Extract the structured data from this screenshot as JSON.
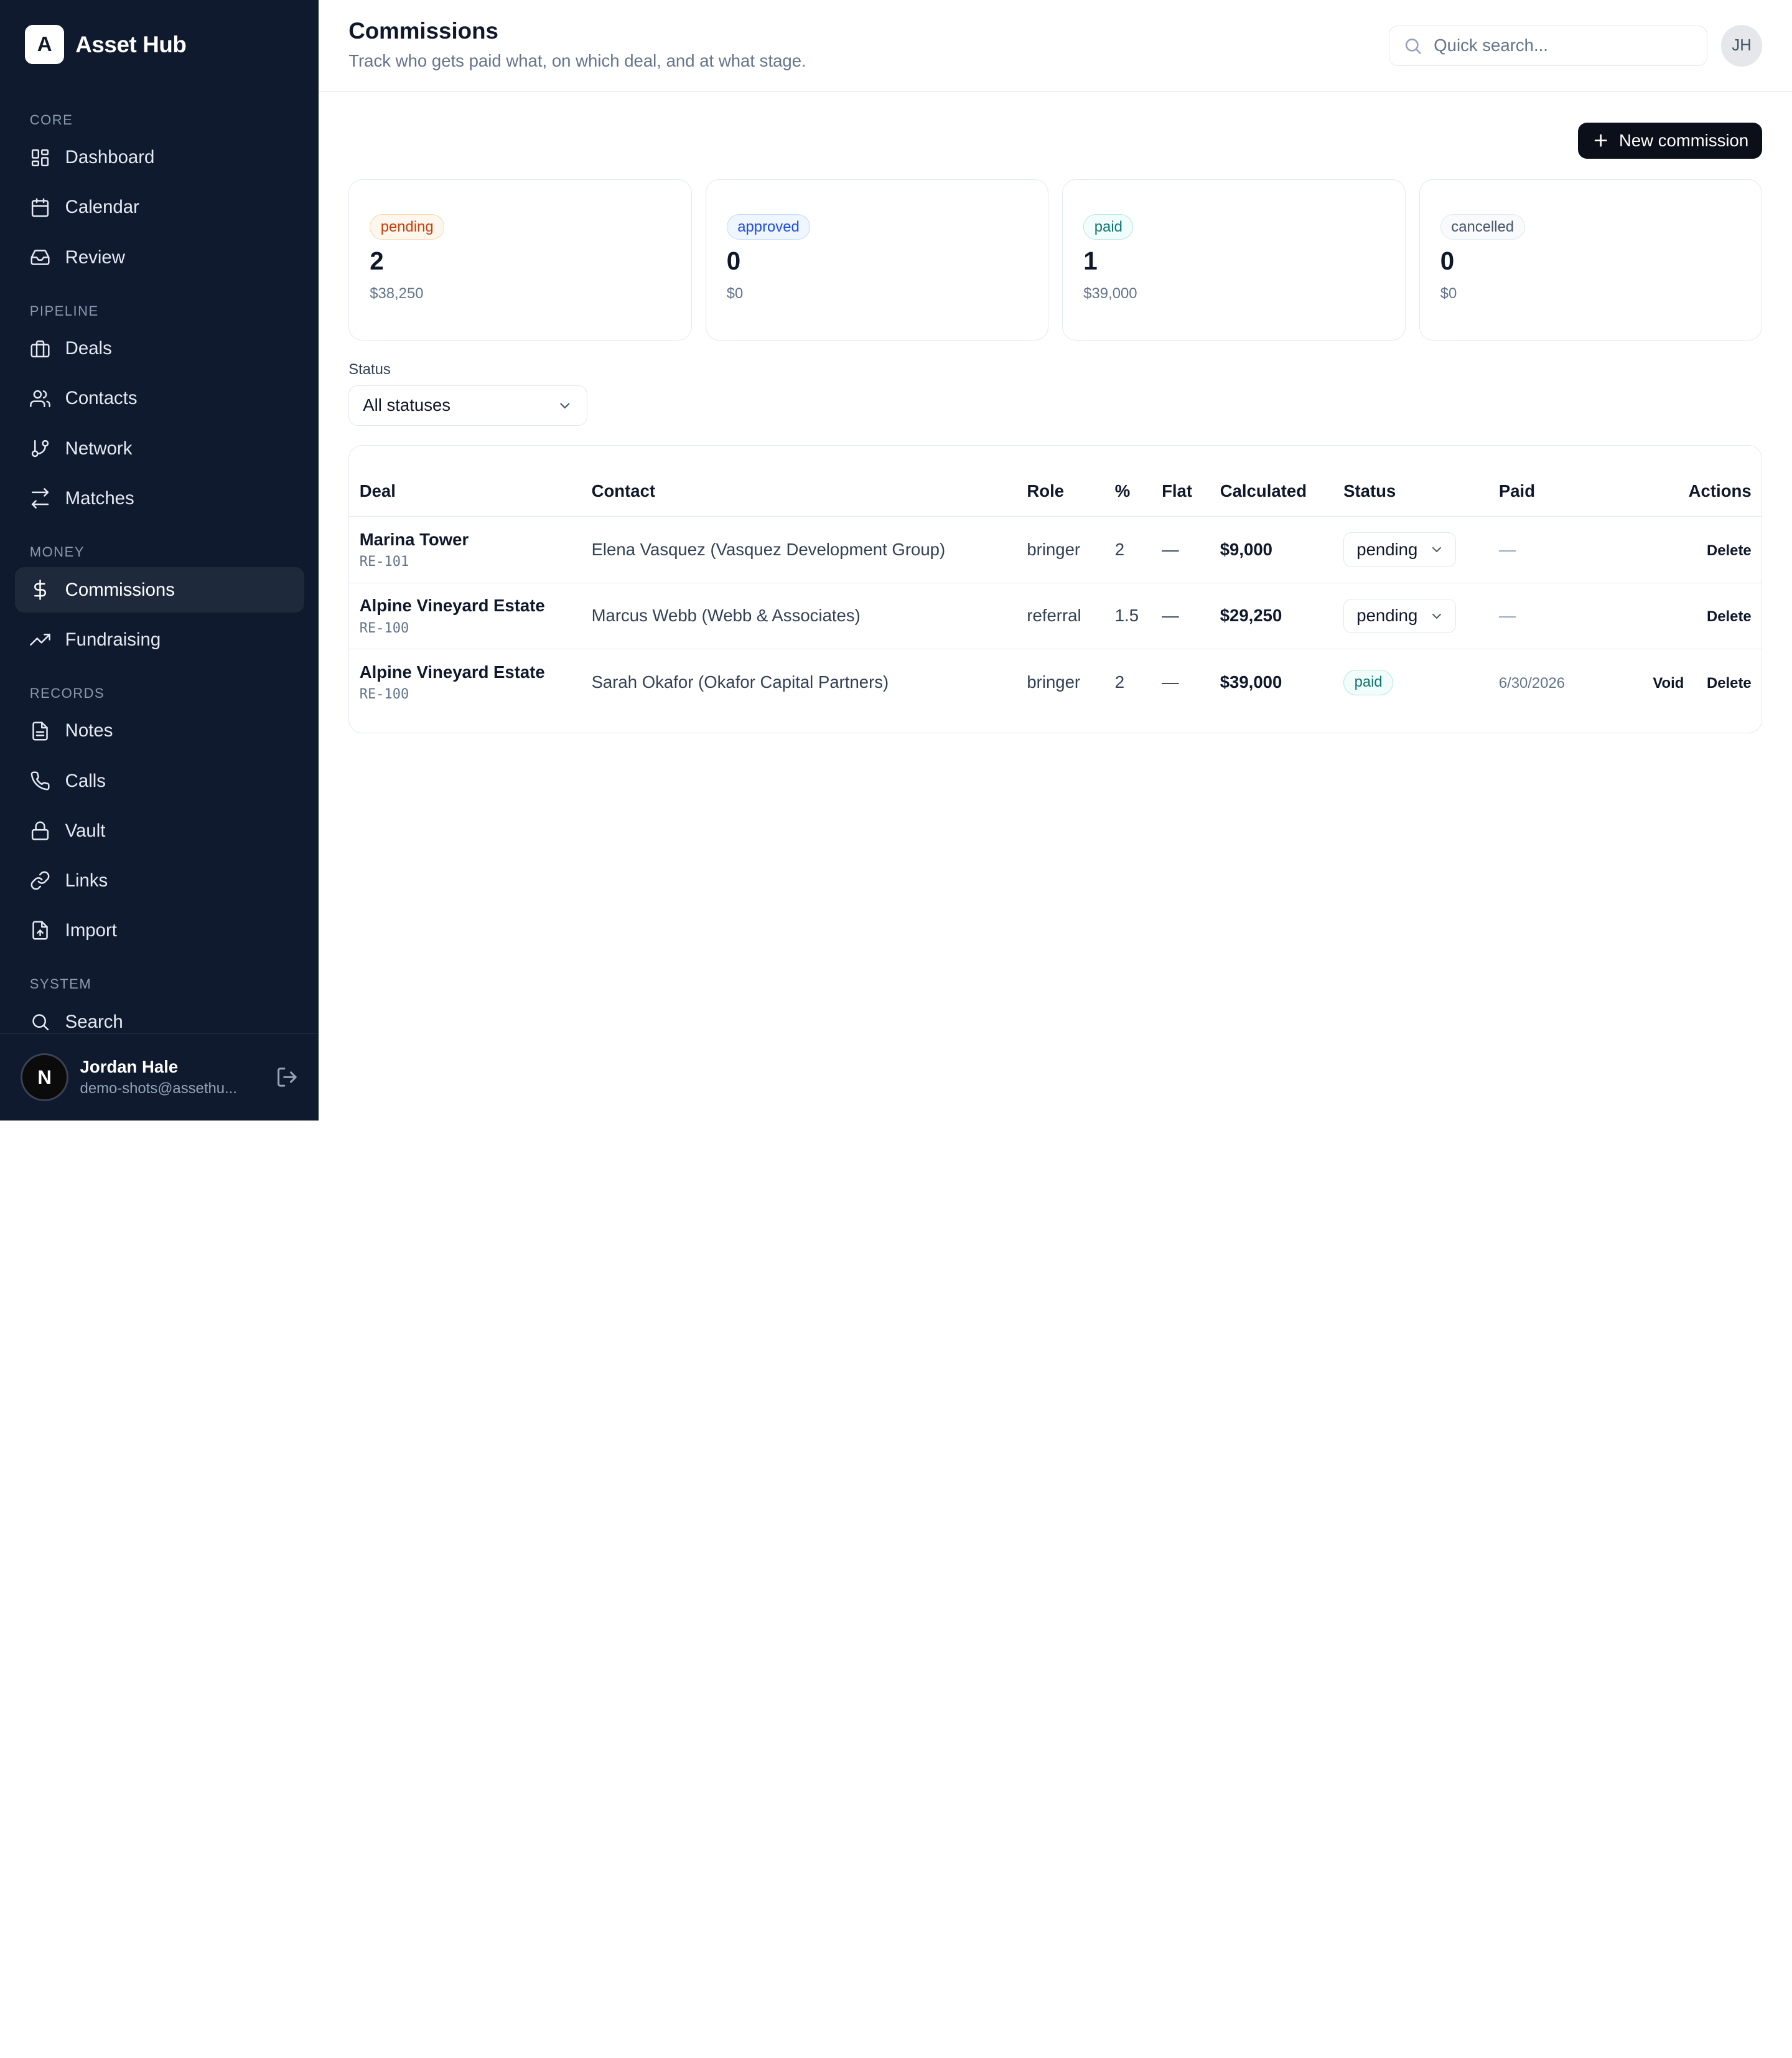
{
  "brand": {
    "logo_letter": "A",
    "name": "Asset Hub"
  },
  "sidebar": {
    "sections": [
      {
        "title": "CORE",
        "items": [
          {
            "label": "Dashboard",
            "icon": "dashboard-icon"
          },
          {
            "label": "Calendar",
            "icon": "calendar-icon"
          },
          {
            "label": "Review",
            "icon": "inbox-icon"
          }
        ]
      },
      {
        "title": "PIPELINE",
        "items": [
          {
            "label": "Deals",
            "icon": "briefcase-icon"
          },
          {
            "label": "Contacts",
            "icon": "users-icon"
          },
          {
            "label": "Network",
            "icon": "git-branch-icon"
          },
          {
            "label": "Matches",
            "icon": "arrows-icon"
          }
        ]
      },
      {
        "title": "MONEY",
        "items": [
          {
            "label": "Commissions",
            "icon": "dollar-icon",
            "active": true
          },
          {
            "label": "Fundraising",
            "icon": "trending-up-icon"
          }
        ]
      },
      {
        "title": "RECORDS",
        "items": [
          {
            "label": "Notes",
            "icon": "file-text-icon"
          },
          {
            "label": "Calls",
            "icon": "phone-icon"
          },
          {
            "label": "Vault",
            "icon": "lock-icon"
          },
          {
            "label": "Links",
            "icon": "link-icon"
          },
          {
            "label": "Import",
            "icon": "file-upload-icon"
          }
        ]
      },
      {
        "title": "SYSTEM",
        "items": [
          {
            "label": "Search",
            "icon": "search-icon"
          }
        ]
      }
    ],
    "user": {
      "avatar_letter": "N",
      "name": "Jordan Hale",
      "email": "demo-shots@assethu..."
    }
  },
  "header": {
    "title": "Commissions",
    "subtitle": "Track who gets paid what, on which deal, and at what stage.",
    "search_placeholder": "Quick search...",
    "avatar_initials": "JH"
  },
  "toolbar": {
    "new_label": "New commission"
  },
  "summary": [
    {
      "status": "pending",
      "count": "2",
      "amount": "$38,250"
    },
    {
      "status": "approved",
      "count": "0",
      "amount": "$0"
    },
    {
      "status": "paid",
      "count": "1",
      "amount": "$39,000"
    },
    {
      "status": "cancelled",
      "count": "0",
      "amount": "$0"
    }
  ],
  "filter": {
    "label": "Status",
    "value": "All statuses"
  },
  "table": {
    "columns": [
      "Deal",
      "Contact",
      "Role",
      "%",
      "Flat",
      "Calculated",
      "Status",
      "Paid",
      "Actions"
    ],
    "rows": [
      {
        "deal": "Marina Tower",
        "code": "RE-101",
        "contact": "Elena Vasquez (Vasquez Development Group)",
        "role": "bringer",
        "pct": "2",
        "flat": "—",
        "calculated": "$9,000",
        "status": "pending",
        "paid": "—",
        "actions": [
          "Delete"
        ]
      },
      {
        "deal": "Alpine Vineyard Estate",
        "code": "RE-100",
        "contact": "Marcus Webb (Webb & Associates)",
        "role": "referral",
        "pct": "1.5",
        "flat": "—",
        "calculated": "$29,250",
        "status": "pending",
        "paid": "—",
        "actions": [
          "Delete"
        ]
      },
      {
        "deal": "Alpine Vineyard Estate",
        "code": "RE-100",
        "contact": "Sarah Okafor (Okafor Capital Partners)",
        "role": "bringer",
        "pct": "2",
        "flat": "—",
        "calculated": "$39,000",
        "status": "paid",
        "paid": "6/30/2026",
        "actions": [
          "Void",
          "Delete"
        ]
      }
    ]
  },
  "colors": {
    "sidebar_bg": "#0f1a2e",
    "active_item_bg": "#1e293b",
    "primary_button": "#0b0f19"
  }
}
